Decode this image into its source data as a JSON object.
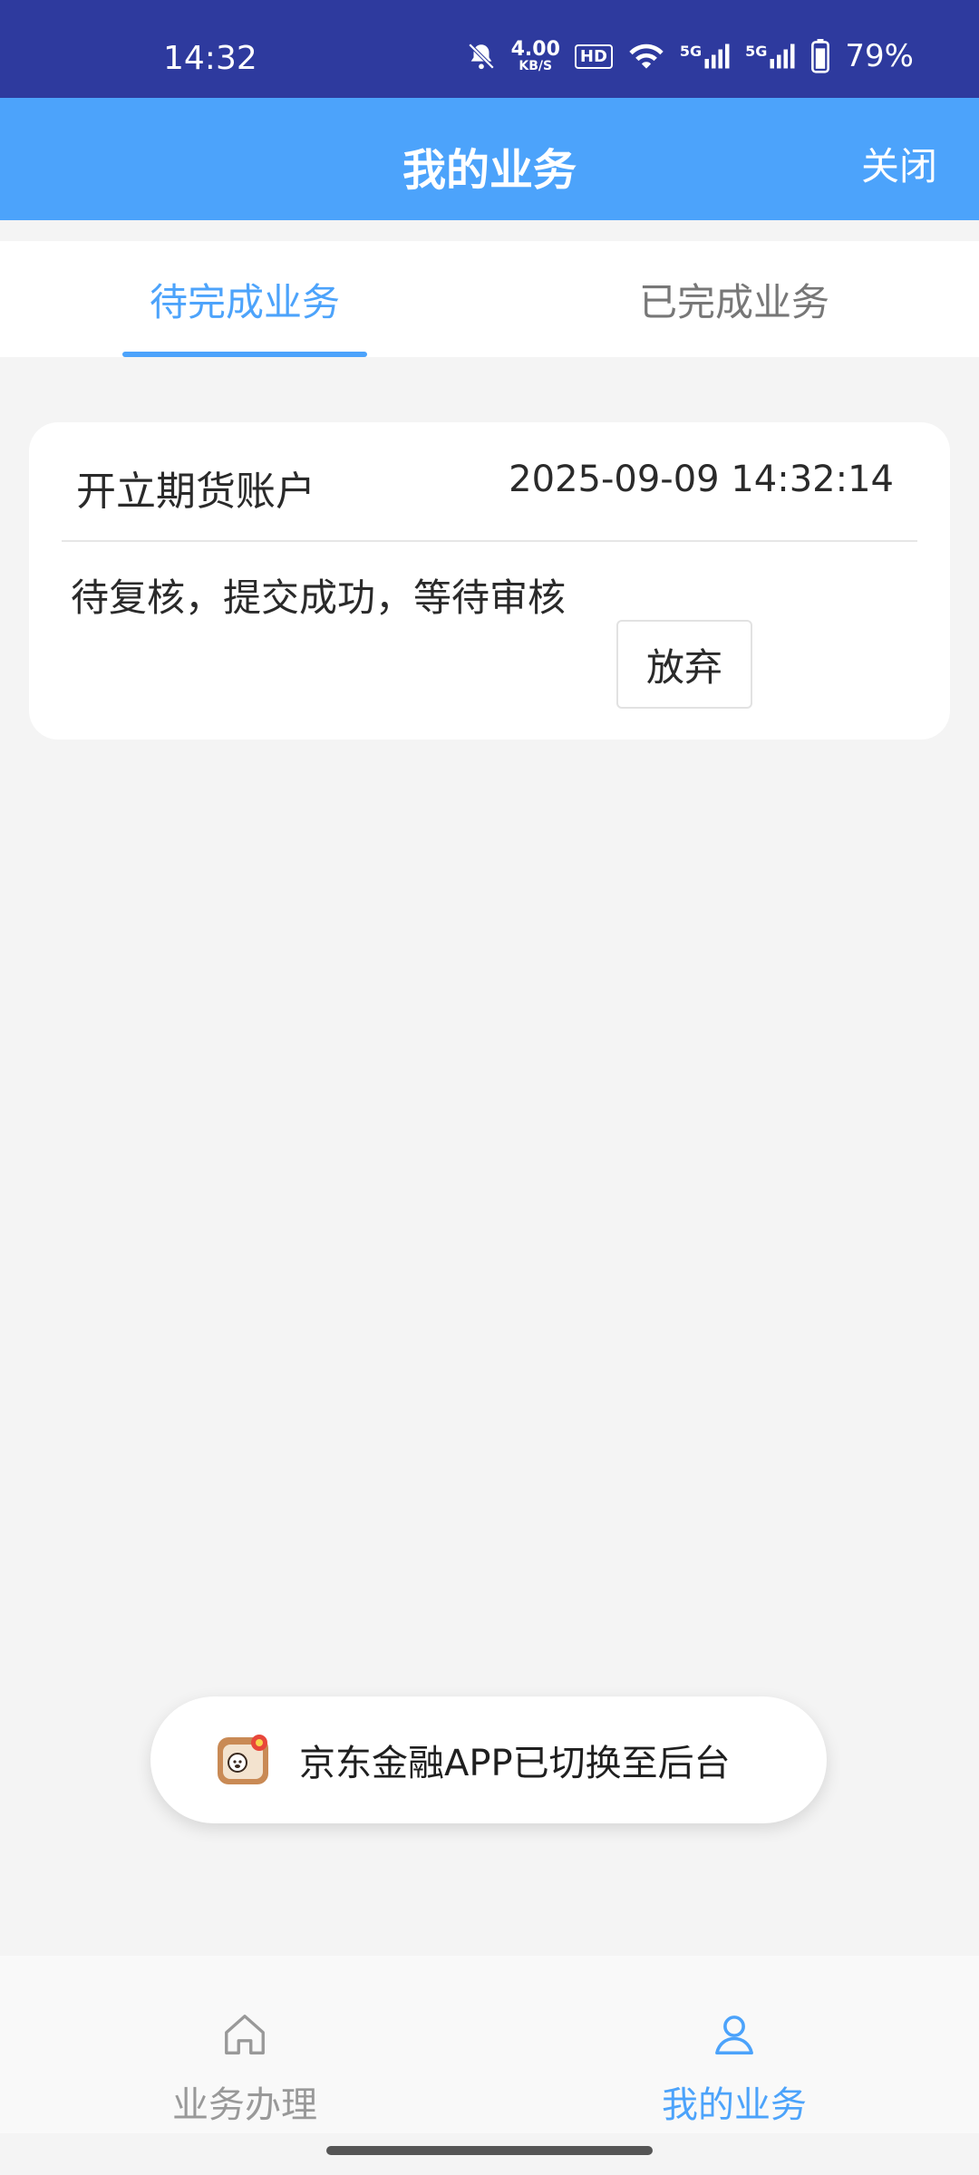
{
  "status_bar": {
    "time": "14:32",
    "speed_value": "4.00",
    "speed_unit": "KB/S",
    "hd": "HD",
    "sig1": "5G",
    "sig2": "5G",
    "battery": "79%"
  },
  "header": {
    "title": "我的业务",
    "close_label": "关闭"
  },
  "tabs": [
    {
      "label": "待完成业务",
      "active": true
    },
    {
      "label": "已完成业务",
      "active": false
    }
  ],
  "card": {
    "title": "开立期货账户",
    "time": "2025-09-09 14:32:14",
    "status": "待复核，提交成功，等待审核",
    "abandon_label": "放弃"
  },
  "toast": {
    "text": "京东金融APP已切换至后台"
  },
  "bottom_nav": [
    {
      "label": "业务办理",
      "icon": "home-icon",
      "active": false
    },
    {
      "label": "我的业务",
      "icon": "user-icon",
      "active": true
    }
  ],
  "colors": {
    "status_bar": "#2e3a9e",
    "header": "#4ca3fb",
    "accent": "#4ca3fb"
  }
}
